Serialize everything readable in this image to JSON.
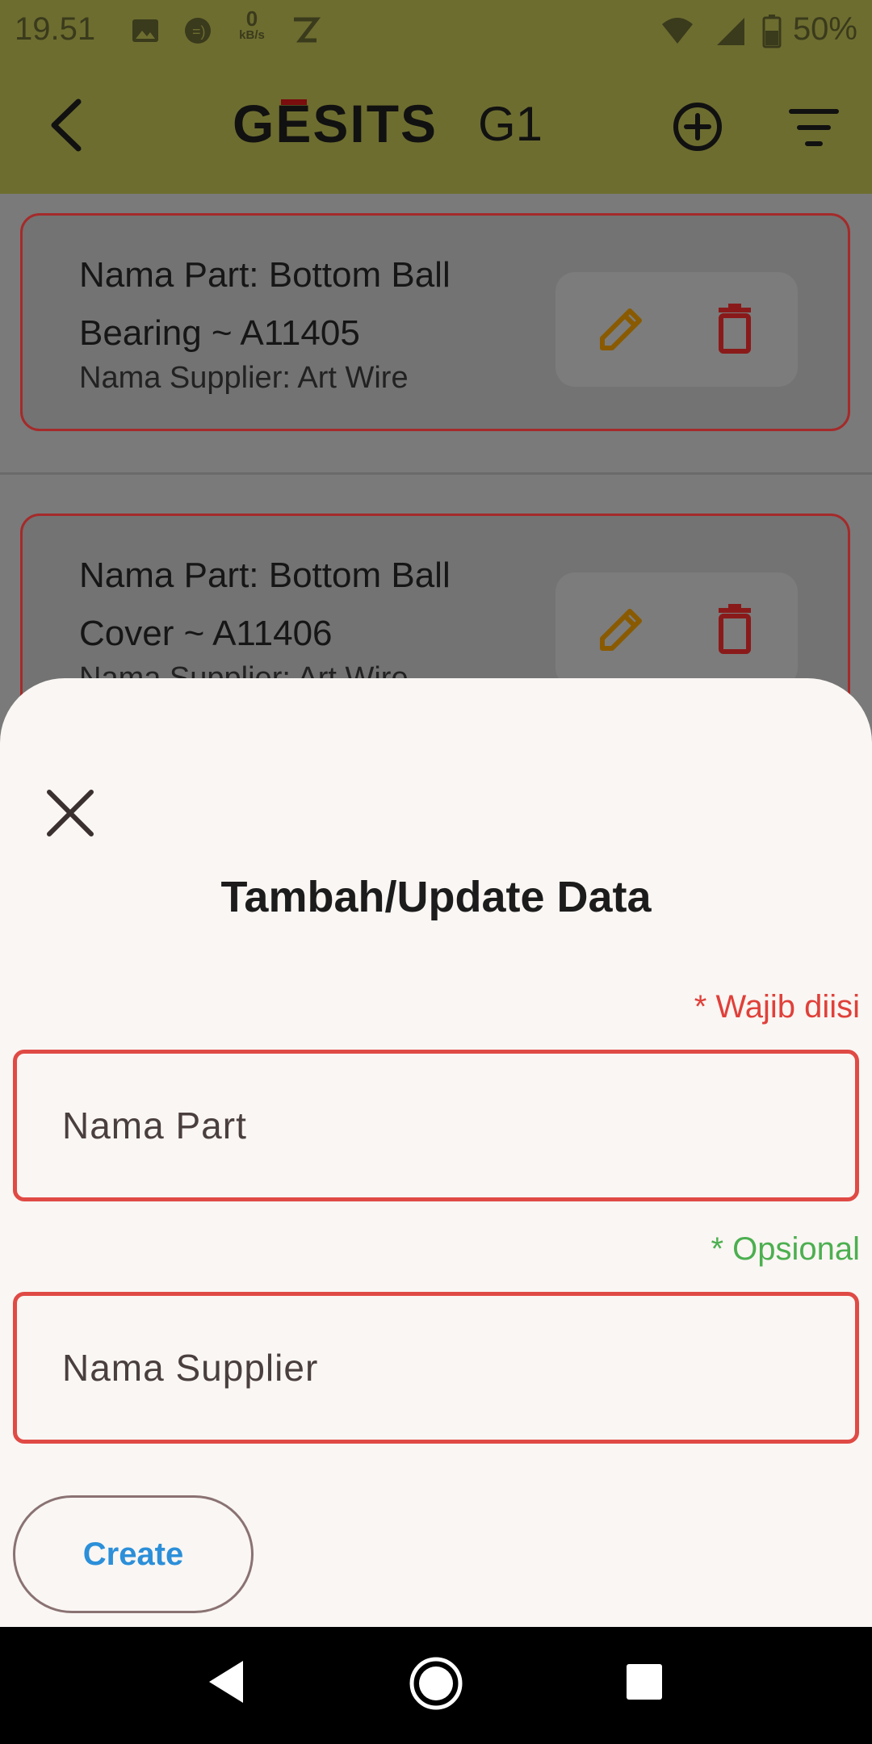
{
  "status_bar": {
    "time": "19.51",
    "network_speed_value": "0",
    "network_speed_unit": "kB/s",
    "battery": "50%",
    "icons": [
      "image-icon",
      "chat-icon",
      "data-speed-icon",
      "z-app-icon",
      "wifi-icon",
      "signal-icon",
      "battery-icon"
    ]
  },
  "app_bar": {
    "logo": "GESITS",
    "model": "G1",
    "back_icon": "back-arrow-icon",
    "add_icon": "add-circle-icon",
    "filter_icon": "filter-icon"
  },
  "list": {
    "items": [
      {
        "title": "Nama Part: Bottom Ball Bearing ~ A11405",
        "supplier": "Nama Supplier: Art Wire"
      },
      {
        "title": "Nama Part: Bottom Ball Cover ~ A11406",
        "supplier": "Nama Supplier: Art Wire"
      }
    ]
  },
  "sheet": {
    "title": "Tambah/Update Data",
    "required_label": "* Wajib diisi",
    "optional_label": "* Opsional",
    "part_placeholder": "Nama Part",
    "supplier_placeholder": "Nama Supplier",
    "create_label": "Create"
  },
  "colors": {
    "app_bar": "#6d6d30",
    "required": "#e0403a",
    "optional": "#4caf50",
    "button_text": "#2b8fd9",
    "edit_icon": "#8a5a00",
    "delete_icon": "#8a1a1a"
  }
}
